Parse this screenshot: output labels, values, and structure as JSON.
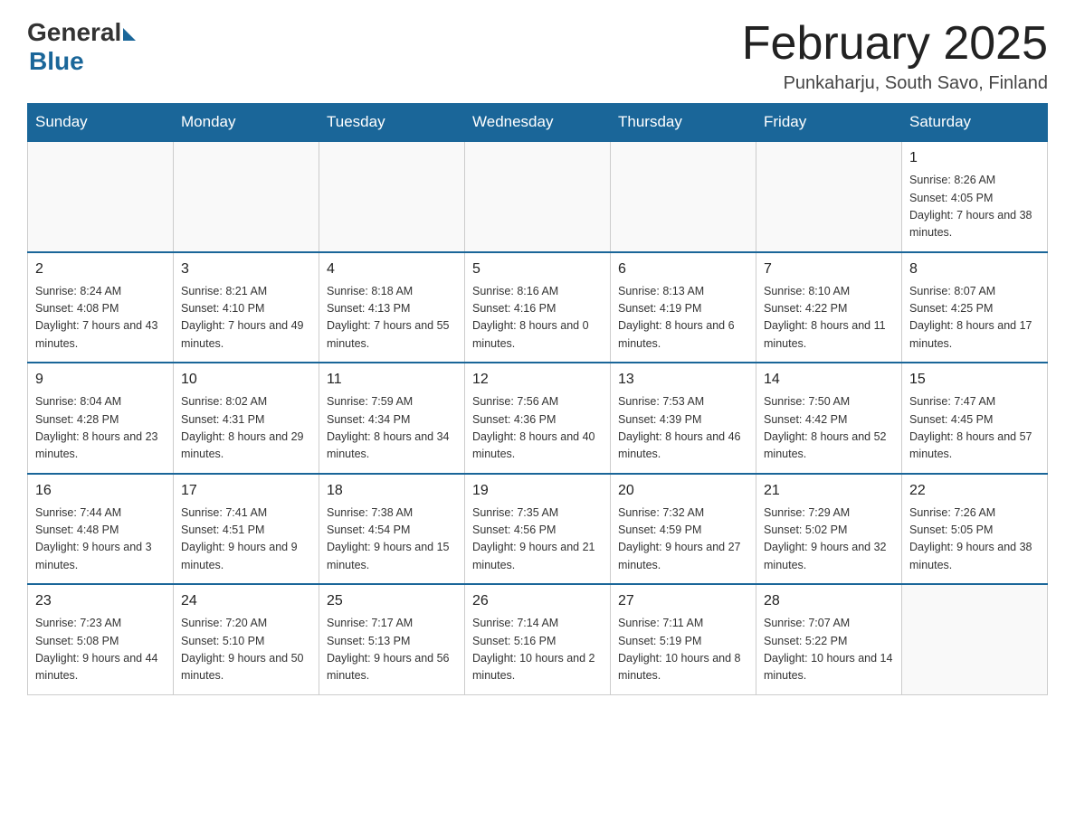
{
  "header": {
    "logo_general": "General",
    "logo_blue": "Blue",
    "title": "February 2025",
    "location": "Punkaharju, South Savo, Finland"
  },
  "calendar": {
    "days_of_week": [
      "Sunday",
      "Monday",
      "Tuesday",
      "Wednesday",
      "Thursday",
      "Friday",
      "Saturday"
    ],
    "weeks": [
      [
        {
          "day": "",
          "info": ""
        },
        {
          "day": "",
          "info": ""
        },
        {
          "day": "",
          "info": ""
        },
        {
          "day": "",
          "info": ""
        },
        {
          "day": "",
          "info": ""
        },
        {
          "day": "",
          "info": ""
        },
        {
          "day": "1",
          "info": "Sunrise: 8:26 AM\nSunset: 4:05 PM\nDaylight: 7 hours and 38 minutes."
        }
      ],
      [
        {
          "day": "2",
          "info": "Sunrise: 8:24 AM\nSunset: 4:08 PM\nDaylight: 7 hours and 43 minutes."
        },
        {
          "day": "3",
          "info": "Sunrise: 8:21 AM\nSunset: 4:10 PM\nDaylight: 7 hours and 49 minutes."
        },
        {
          "day": "4",
          "info": "Sunrise: 8:18 AM\nSunset: 4:13 PM\nDaylight: 7 hours and 55 minutes."
        },
        {
          "day": "5",
          "info": "Sunrise: 8:16 AM\nSunset: 4:16 PM\nDaylight: 8 hours and 0 minutes."
        },
        {
          "day": "6",
          "info": "Sunrise: 8:13 AM\nSunset: 4:19 PM\nDaylight: 8 hours and 6 minutes."
        },
        {
          "day": "7",
          "info": "Sunrise: 8:10 AM\nSunset: 4:22 PM\nDaylight: 8 hours and 11 minutes."
        },
        {
          "day": "8",
          "info": "Sunrise: 8:07 AM\nSunset: 4:25 PM\nDaylight: 8 hours and 17 minutes."
        }
      ],
      [
        {
          "day": "9",
          "info": "Sunrise: 8:04 AM\nSunset: 4:28 PM\nDaylight: 8 hours and 23 minutes."
        },
        {
          "day": "10",
          "info": "Sunrise: 8:02 AM\nSunset: 4:31 PM\nDaylight: 8 hours and 29 minutes."
        },
        {
          "day": "11",
          "info": "Sunrise: 7:59 AM\nSunset: 4:34 PM\nDaylight: 8 hours and 34 minutes."
        },
        {
          "day": "12",
          "info": "Sunrise: 7:56 AM\nSunset: 4:36 PM\nDaylight: 8 hours and 40 minutes."
        },
        {
          "day": "13",
          "info": "Sunrise: 7:53 AM\nSunset: 4:39 PM\nDaylight: 8 hours and 46 minutes."
        },
        {
          "day": "14",
          "info": "Sunrise: 7:50 AM\nSunset: 4:42 PM\nDaylight: 8 hours and 52 minutes."
        },
        {
          "day": "15",
          "info": "Sunrise: 7:47 AM\nSunset: 4:45 PM\nDaylight: 8 hours and 57 minutes."
        }
      ],
      [
        {
          "day": "16",
          "info": "Sunrise: 7:44 AM\nSunset: 4:48 PM\nDaylight: 9 hours and 3 minutes."
        },
        {
          "day": "17",
          "info": "Sunrise: 7:41 AM\nSunset: 4:51 PM\nDaylight: 9 hours and 9 minutes."
        },
        {
          "day": "18",
          "info": "Sunrise: 7:38 AM\nSunset: 4:54 PM\nDaylight: 9 hours and 15 minutes."
        },
        {
          "day": "19",
          "info": "Sunrise: 7:35 AM\nSunset: 4:56 PM\nDaylight: 9 hours and 21 minutes."
        },
        {
          "day": "20",
          "info": "Sunrise: 7:32 AM\nSunset: 4:59 PM\nDaylight: 9 hours and 27 minutes."
        },
        {
          "day": "21",
          "info": "Sunrise: 7:29 AM\nSunset: 5:02 PM\nDaylight: 9 hours and 32 minutes."
        },
        {
          "day": "22",
          "info": "Sunrise: 7:26 AM\nSunset: 5:05 PM\nDaylight: 9 hours and 38 minutes."
        }
      ],
      [
        {
          "day": "23",
          "info": "Sunrise: 7:23 AM\nSunset: 5:08 PM\nDaylight: 9 hours and 44 minutes."
        },
        {
          "day": "24",
          "info": "Sunrise: 7:20 AM\nSunset: 5:10 PM\nDaylight: 9 hours and 50 minutes."
        },
        {
          "day": "25",
          "info": "Sunrise: 7:17 AM\nSunset: 5:13 PM\nDaylight: 9 hours and 56 minutes."
        },
        {
          "day": "26",
          "info": "Sunrise: 7:14 AM\nSunset: 5:16 PM\nDaylight: 10 hours and 2 minutes."
        },
        {
          "day": "27",
          "info": "Sunrise: 7:11 AM\nSunset: 5:19 PM\nDaylight: 10 hours and 8 minutes."
        },
        {
          "day": "28",
          "info": "Sunrise: 7:07 AM\nSunset: 5:22 PM\nDaylight: 10 hours and 14 minutes."
        },
        {
          "day": "",
          "info": ""
        }
      ]
    ]
  }
}
